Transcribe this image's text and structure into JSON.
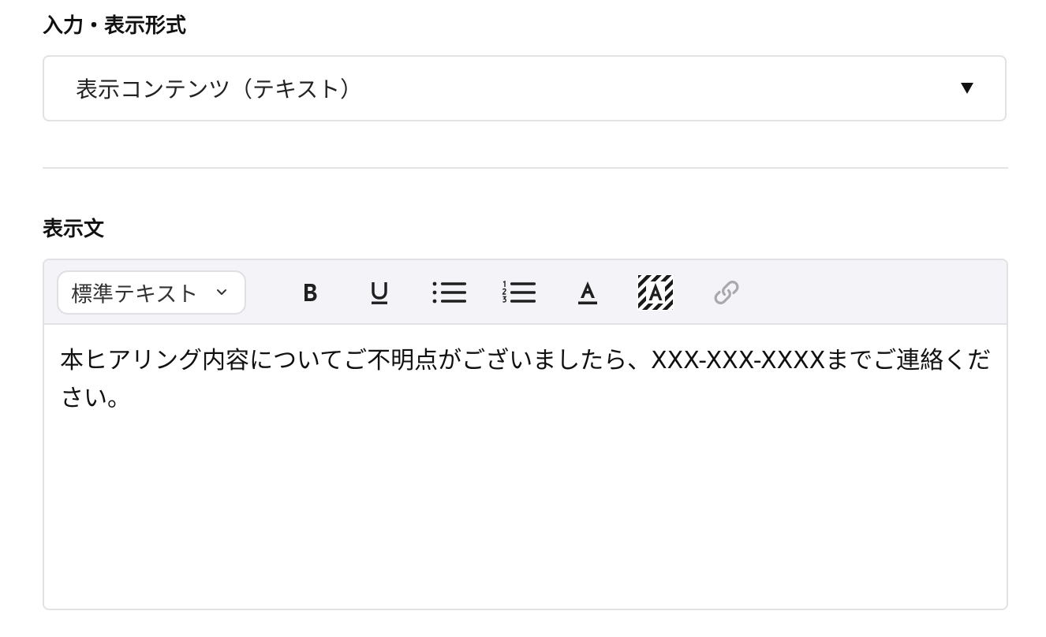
{
  "format_section": {
    "label": "入力・表示形式",
    "select_value": "表示コンテンツ（テキスト）"
  },
  "display_section": {
    "label": "表示文",
    "toolbar": {
      "text_style_value": "標準テキスト",
      "buttons": [
        {
          "name": "bold",
          "icon": "bold-icon"
        },
        {
          "name": "underline",
          "icon": "underline-icon"
        },
        {
          "name": "bullet-list",
          "icon": "bulleted-list-icon"
        },
        {
          "name": "numbered-list",
          "icon": "numbered-list-icon"
        },
        {
          "name": "text-color",
          "icon": "text-color-icon"
        },
        {
          "name": "highlight-color",
          "icon": "background-color-icon"
        },
        {
          "name": "link",
          "icon": "link-icon",
          "disabled": true
        }
      ]
    },
    "content": "本ヒアリング内容についてご不明点がございましたら、XXX-XXX-XXXXまでご連絡ください。"
  },
  "colors": {
    "border": "#e2e2e4",
    "toolbar_bg": "#f4f4f8",
    "icon": "#1f1f1f",
    "disabled_icon": "#a8a8ad"
  }
}
